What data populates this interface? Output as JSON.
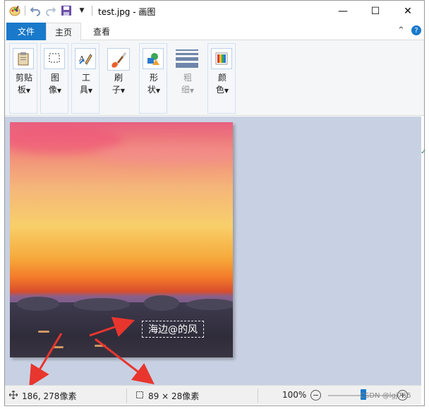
{
  "window": {
    "title": "test.jpg - 画图"
  },
  "title_controls": {
    "minimize": "—",
    "maximize": "☐",
    "close": "✕"
  },
  "tabs": {
    "file": "文件",
    "home": "主页",
    "view": "查看"
  },
  "ribbon": {
    "groups": [
      {
        "label_line1": "剪贴",
        "label_line2": "板",
        "icon": "clipboard-icon",
        "disabled": false
      },
      {
        "label_line1": "图",
        "label_line2": "像",
        "icon": "select-icon",
        "disabled": false
      },
      {
        "label_line1": "工",
        "label_line2": "具",
        "icon": "tools-icon",
        "disabled": false
      },
      {
        "label_line1": "刷",
        "label_line2": "子",
        "icon": "brush-icon",
        "disabled": false
      },
      {
        "label_line1": "形",
        "label_line2": "状",
        "icon": "shapes-icon",
        "disabled": false
      },
      {
        "label_line1": "粗",
        "label_line2": "细",
        "icon": "line-width-icon",
        "disabled": true
      },
      {
        "label_line1": "颜",
        "label_line2": "色",
        "icon": "colors-icon",
        "disabled": false
      }
    ]
  },
  "canvas": {
    "text_box": "海边@的风"
  },
  "statusbar": {
    "cursor_position": "186, 278像素",
    "selection_size": "89 × 28像素",
    "zoom_level": "100%",
    "zoom_slider_value": 0.5
  },
  "watermark": "CSDN @lgj765"
}
